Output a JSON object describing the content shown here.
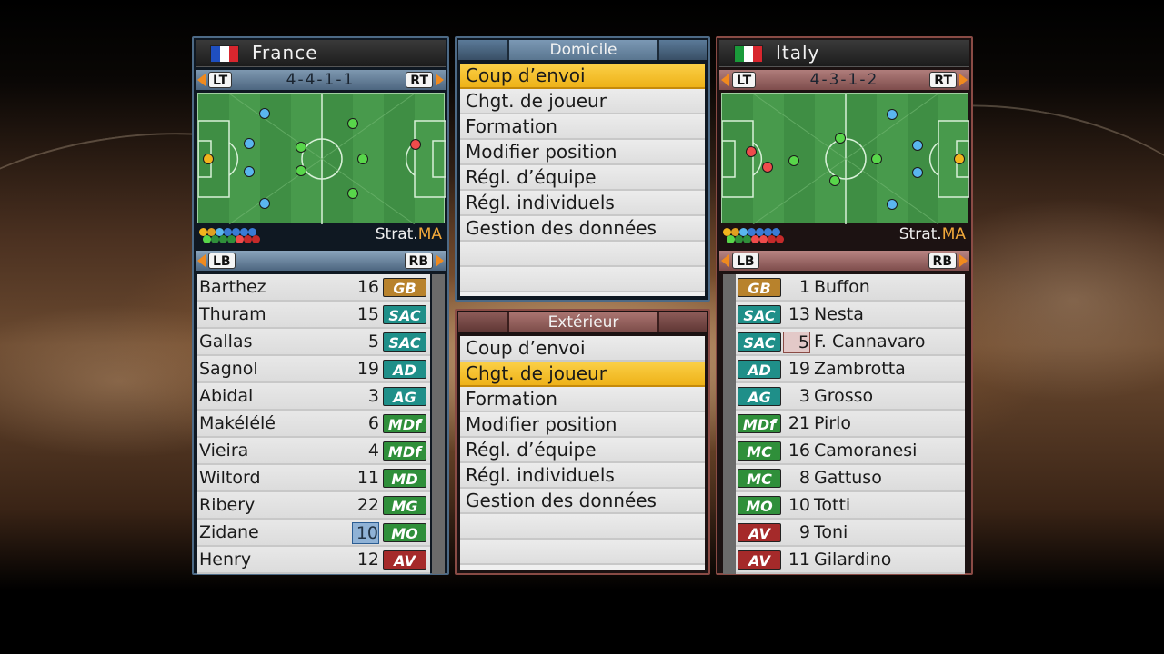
{
  "left_team": {
    "name": "France",
    "flag_colors": [
      "#1f4fbf",
      "#ffffff",
      "#d8262e"
    ],
    "lt_label": "LT",
    "rt_label": "RT",
    "formation": "4-4-1-1",
    "strategy_prefix": "Strat.",
    "strategy_value": "MA",
    "lb_label": "LB",
    "rb_label": "RB",
    "players": [
      {
        "name": "Barthez",
        "number": "16",
        "position": "GB"
      },
      {
        "name": "Thuram",
        "number": "15",
        "position": "SAC"
      },
      {
        "name": "Gallas",
        "number": "5",
        "position": "SAC"
      },
      {
        "name": "Sagnol",
        "number": "19",
        "position": "AD"
      },
      {
        "name": "Abidal",
        "number": "3",
        "position": "AG"
      },
      {
        "name": "Makélélé",
        "number": "6",
        "position": "MDf"
      },
      {
        "name": "Vieira",
        "number": "4",
        "position": "MDf"
      },
      {
        "name": "Wiltord",
        "number": "11",
        "position": "MD"
      },
      {
        "name": "Ribery",
        "number": "22",
        "position": "MG"
      },
      {
        "name": "Zidane",
        "number": "10",
        "position": "MO"
      },
      {
        "name": "Henry",
        "number": "12",
        "position": "AV"
      }
    ]
  },
  "right_team": {
    "name": "Italy",
    "flag_colors": [
      "#1a9a3a",
      "#ffffff",
      "#d8262e"
    ],
    "lt_label": "LT",
    "rt_label": "RT",
    "formation": "4-3-1-2",
    "strategy_prefix": "Strat.",
    "strategy_value": "MA",
    "lb_label": "LB",
    "rb_label": "RB",
    "players": [
      {
        "name": "Buffon",
        "number": "1",
        "position": "GB"
      },
      {
        "name": "Nesta",
        "number": "13",
        "position": "SAC"
      },
      {
        "name": "F. Cannavaro",
        "number": "5",
        "position": "SAC"
      },
      {
        "name": "Zambrotta",
        "number": "19",
        "position": "AD"
      },
      {
        "name": "Grosso",
        "number": "3",
        "position": "AG"
      },
      {
        "name": "Pirlo",
        "number": "21",
        "position": "MDf"
      },
      {
        "name": "Camoranesi",
        "number": "16",
        "position": "MC"
      },
      {
        "name": "Gattuso",
        "number": "8",
        "position": "MC"
      },
      {
        "name": "Totti",
        "number": "10",
        "position": "MO"
      },
      {
        "name": "Toni",
        "number": "9",
        "position": "AV"
      },
      {
        "name": "Gilardino",
        "number": "11",
        "position": "AV"
      }
    ]
  },
  "home_menu": {
    "title": "Domicile",
    "items": [
      "Coup d’envoi",
      "Chgt. de joueur",
      "Formation",
      "Modifier position",
      "Régl. d’équipe",
      "Régl. individuels",
      "Gestion des données"
    ],
    "selected_index": 0
  },
  "away_menu": {
    "title": "Extérieur",
    "items": [
      "Coup d’envoi",
      "Chgt. de joueur",
      "Formation",
      "Modifier position",
      "Régl. d’équipe",
      "Régl. individuels",
      "Gestion des données"
    ],
    "selected_index": 1
  },
  "colors": {
    "selection": "#f2b51d",
    "home_accent": "#4d6a86",
    "away_accent": "#8a4b45"
  }
}
